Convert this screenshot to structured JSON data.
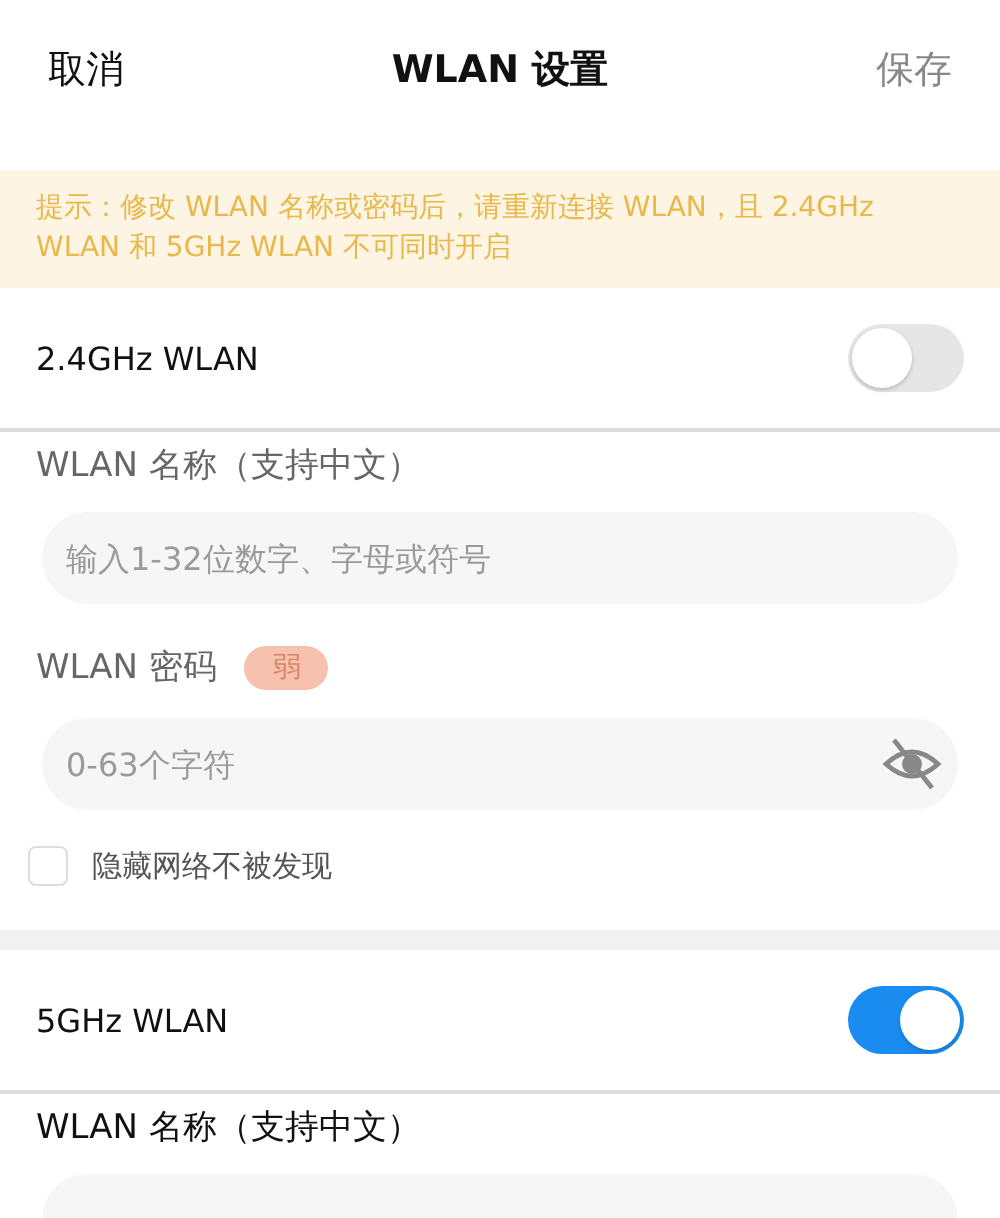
{
  "header": {
    "cancel": "取消",
    "title": "WLAN 设置",
    "save": "保存",
    "save_disabled": true
  },
  "notice": "提示：修改 WLAN 名称或密码后，请重新连接 WLAN，且 2.4GHz WLAN 和 5GHz WLAN 不可同时开启",
  "bands": [
    {
      "label": "2.4GHz WLAN",
      "on": false,
      "name_label": "WLAN 名称（支持中文）",
      "name_placeholder": "输入1-32位数字、字母或符号",
      "password_label": "WLAN 密码",
      "strength": "弱",
      "password_placeholder": "0-63个字符",
      "hide_network": {
        "label": "隐藏网络不被发现",
        "checked": false
      }
    },
    {
      "label": "5GHz WLAN",
      "on": true,
      "name_label": "WLAN 名称（支持中文）"
    }
  ]
}
